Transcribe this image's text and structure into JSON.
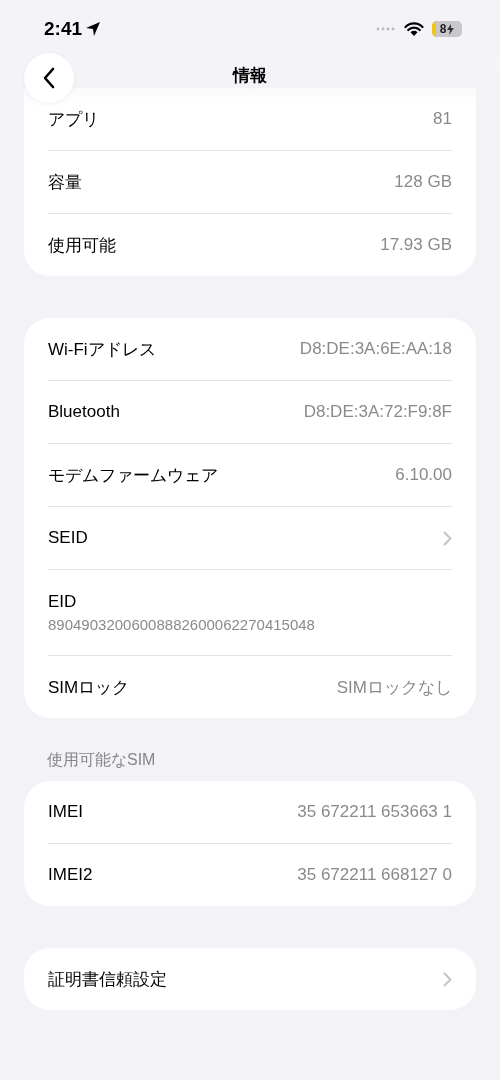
{
  "status_bar": {
    "time": "2:41",
    "battery": "8"
  },
  "nav": {
    "title": "情報"
  },
  "groups": [
    {
      "rows": [
        {
          "kind": "value",
          "label": "アプリ",
          "value": "81"
        },
        {
          "kind": "value",
          "label": "容量",
          "value": "128 GB"
        },
        {
          "kind": "value",
          "label": "使用可能",
          "value": "17.93 GB"
        }
      ]
    },
    {
      "rows": [
        {
          "kind": "value",
          "label": "Wi-Fiアドレス",
          "value": "D8:DE:3A:6E:AA:18"
        },
        {
          "kind": "value",
          "label": "Bluetooth",
          "value": "D8:DE:3A:72:F9:8F"
        },
        {
          "kind": "value",
          "label": "モデムファームウェア",
          "value": "6.10.00"
        },
        {
          "kind": "chevron",
          "label": "SEID"
        },
        {
          "kind": "stacked",
          "label": "EID",
          "value": "89049032006008882600062270415048"
        },
        {
          "kind": "value",
          "label": "SIMロック",
          "value": "SIMロックなし"
        }
      ]
    },
    {
      "header": "使用可能なSIM",
      "rows": [
        {
          "kind": "value",
          "label": "IMEI",
          "value": "35 672211 653663 1"
        },
        {
          "kind": "value",
          "label": "IMEI2",
          "value": "35 672211 668127 0"
        }
      ]
    },
    {
      "rows": [
        {
          "kind": "chevron",
          "label": "証明書信頼設定"
        }
      ]
    }
  ]
}
